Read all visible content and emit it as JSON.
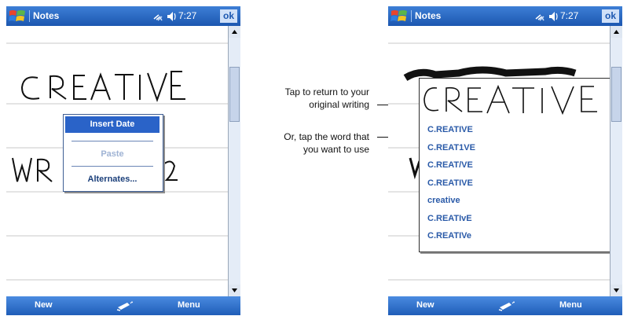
{
  "left_screen": {
    "app_title": "Notes",
    "clock": "7:27",
    "ok_label": "ok",
    "handwriting_line1": "CREATIVE",
    "context_menu": {
      "insert_date": "Insert Date",
      "paste": "Paste",
      "alternates": "Alternates..."
    },
    "menubar": {
      "new_label": "New",
      "menu_label": "Menu"
    }
  },
  "right_screen": {
    "app_title": "Notes",
    "clock": "7:27",
    "ok_label": "ok",
    "original_writing": "CREATIVE",
    "alternates": [
      "C.REATIVE",
      "C.REAT1VE",
      "C.REAT/VE",
      "C.REATIVE",
      "creative",
      "C.REATIvE",
      "C.REATIVe"
    ],
    "menubar": {
      "new_label": "New",
      "menu_label": "Menu"
    }
  },
  "callouts": {
    "return_line1": "Tap to return to your",
    "return_line2": "original writing",
    "choose_line1": "Or, tap the word that",
    "choose_line2": "you want to use"
  },
  "colors": {
    "titlebar": "#1c57b0",
    "menubar": "#1f5db8",
    "menu_highlight": "#2a63c8",
    "alternate_text": "#2a5aa8",
    "ruled_line": "#c8c8c8"
  },
  "icons": [
    "windows-start-icon",
    "connectivity-icon",
    "speaker-icon",
    "pen-input-icon"
  ]
}
